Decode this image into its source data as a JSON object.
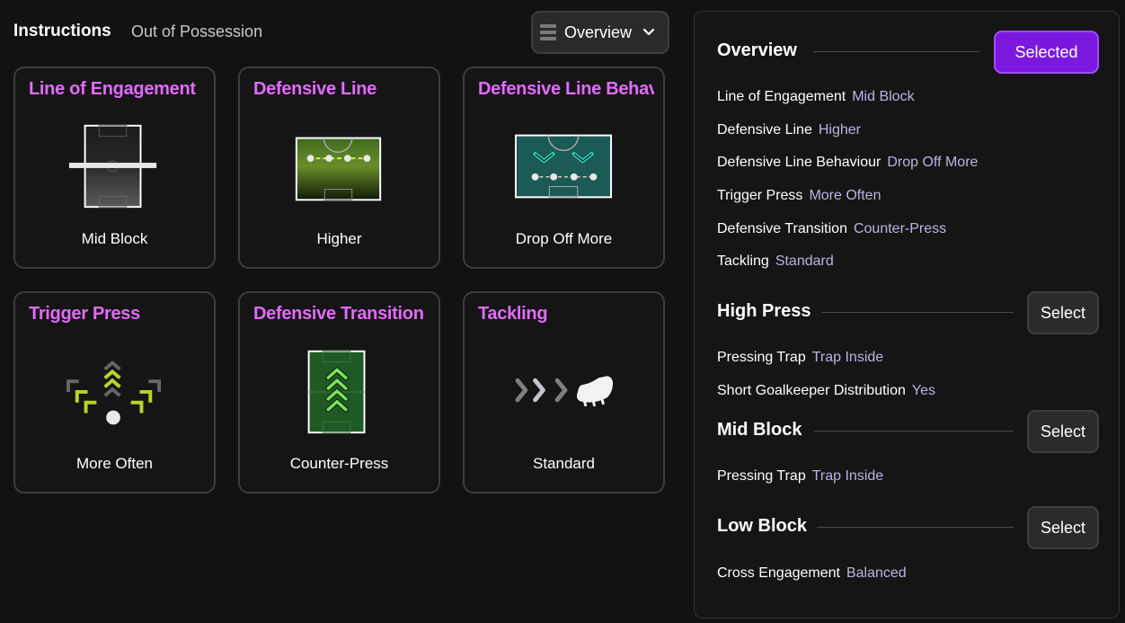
{
  "header": {
    "title": "Instructions",
    "subtitle": "Out of Possession",
    "view_selector": "Overview"
  },
  "cards": [
    {
      "title": "Line of Engagement",
      "value": "Mid Block"
    },
    {
      "title": "Defensive Line",
      "value": "Higher"
    },
    {
      "title": "Defensive Line Behavio",
      "value": "Drop Off More"
    },
    {
      "title": "Trigger Press",
      "value": "More Often"
    },
    {
      "title": "Defensive Transition",
      "value": "Counter-Press"
    },
    {
      "title": "Tackling",
      "value": "Standard"
    }
  ],
  "panel": {
    "sections": [
      {
        "title": "Overview",
        "button": "Selected",
        "items": [
          {
            "key": "Line of Engagement",
            "value": "Mid Block"
          },
          {
            "key": "Defensive Line",
            "value": "Higher"
          },
          {
            "key": "Defensive Line Behaviour",
            "value": "Drop Off More"
          },
          {
            "key": "Trigger Press",
            "value": "More Often"
          },
          {
            "key": "Defensive Transition",
            "value": "Counter-Press"
          },
          {
            "key": "Tackling",
            "value": "Standard"
          }
        ]
      },
      {
        "title": "High Press",
        "button": "Select",
        "items": [
          {
            "key": "Pressing Trap",
            "value": "Trap Inside"
          },
          {
            "key": "Short Goalkeeper Distribution",
            "value": "Yes"
          }
        ]
      },
      {
        "title": "Mid Block",
        "button": "Select",
        "items": [
          {
            "key": "Pressing Trap",
            "value": "Trap Inside"
          }
        ]
      },
      {
        "title": "Low Block",
        "button": "Select",
        "items": [
          {
            "key": "Cross Engagement",
            "value": "Balanced"
          }
        ]
      }
    ]
  },
  "colors": {
    "accent_title": "#e36bff",
    "selected_button": "#7b18e0",
    "value_text": "#b9b6e2",
    "background": "#121212"
  },
  "icons": {
    "view_selector": "list-icon",
    "dropdown": "chevron-down-icon",
    "card_1": "pitch-mid-block-icon",
    "card_2": "pitch-high-line-icon",
    "card_3": "pitch-drop-off-icon",
    "card_4": "press-arrows-icon",
    "card_5": "pitch-counter-press-icon",
    "card_6": "boot-tackle-icon"
  }
}
